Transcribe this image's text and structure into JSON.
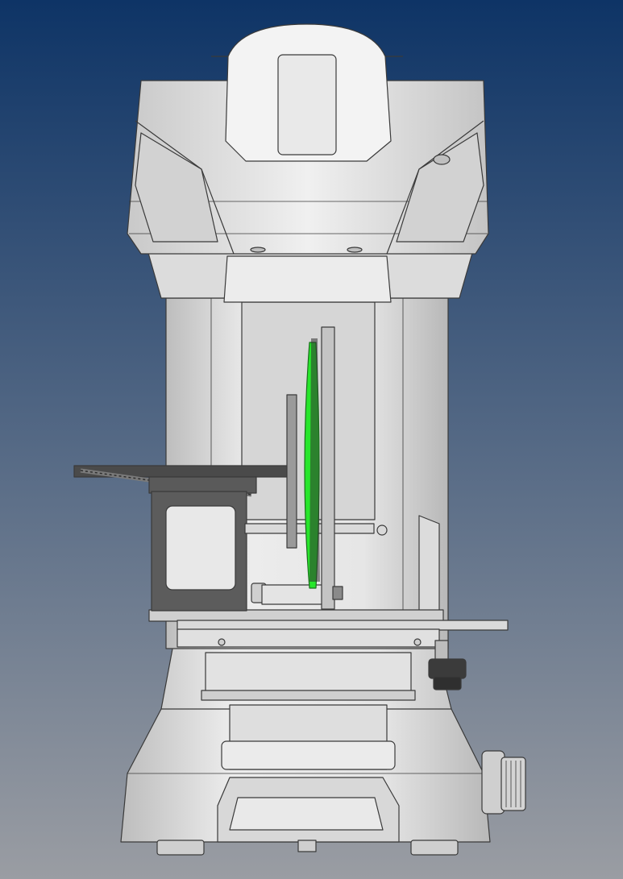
{
  "scene": {
    "subject": "cad-render-front-view",
    "background": {
      "top": "#0e3466",
      "bottom": "#9a9da3"
    },
    "colors": {
      "housing": "#e4e4e4",
      "housing_dark": "#cfcfcf",
      "outline": "#3a3a3a",
      "fixture": "#5c5c5c",
      "fixture_dark": "#3b3b3b",
      "highlight_green": "#27e62b",
      "rod": "#bdbdbd"
    }
  }
}
